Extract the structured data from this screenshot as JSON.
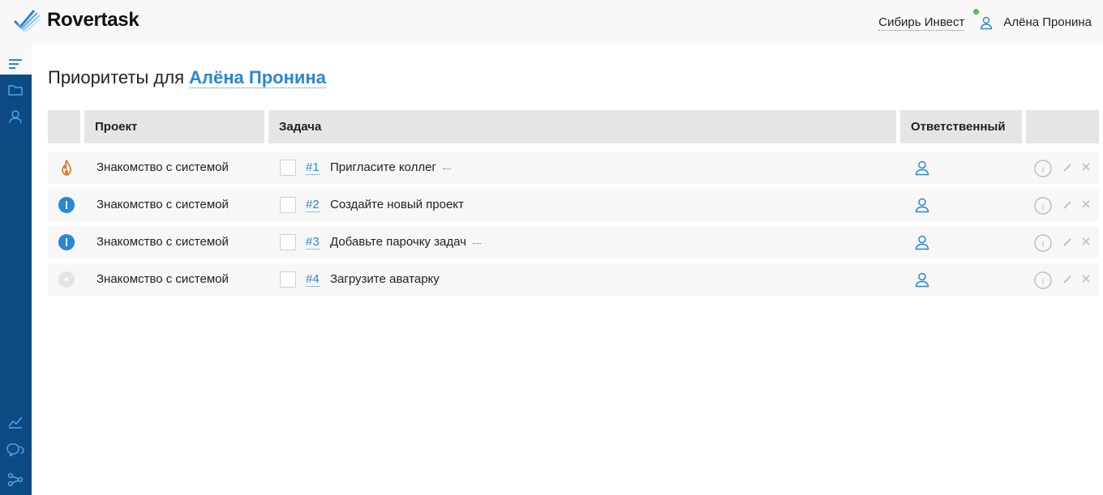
{
  "app": {
    "name": "Rovertask"
  },
  "header": {
    "company": "Сибирь Инвест",
    "user": "Алёна Пронина",
    "online_color": "#5cb85c"
  },
  "sidebar": {
    "color": "#0d4a83",
    "top_icons": [
      "priorities-icon",
      "folder-icon",
      "user-icon"
    ],
    "bottom_icons": [
      "chart-icon",
      "chat-icon",
      "share-icon"
    ]
  },
  "page": {
    "title_prefix": "Приоритеты для",
    "title_user": "Алёна Пронина"
  },
  "table": {
    "headers": {
      "project": "Проект",
      "task": "Задача",
      "assignee": "Ответственный"
    },
    "rows": [
      {
        "priority": "fire-icon",
        "project": "Знакомство с системой",
        "number": "#1",
        "title": "Пригласите коллег",
        "has_more": true
      },
      {
        "priority": "exclamation-icon",
        "project": "Знакомство с системой",
        "number": "#2",
        "title": "Создайте новый проект",
        "has_more": false
      },
      {
        "priority": "exclamation-icon",
        "project": "Знакомство с системой",
        "number": "#3",
        "title": "Добавьте парочку задач",
        "has_more": true
      },
      {
        "priority": "low-dot-icon",
        "project": "Знакомство с системой",
        "number": "#4",
        "title": "Загрузите аватарку",
        "has_more": false
      }
    ]
  },
  "colors": {
    "accent": "#2b86d4",
    "fire": "#e8701a",
    "header_bg": "#e4e5e7",
    "row_bg": "#f7f7f7"
  }
}
